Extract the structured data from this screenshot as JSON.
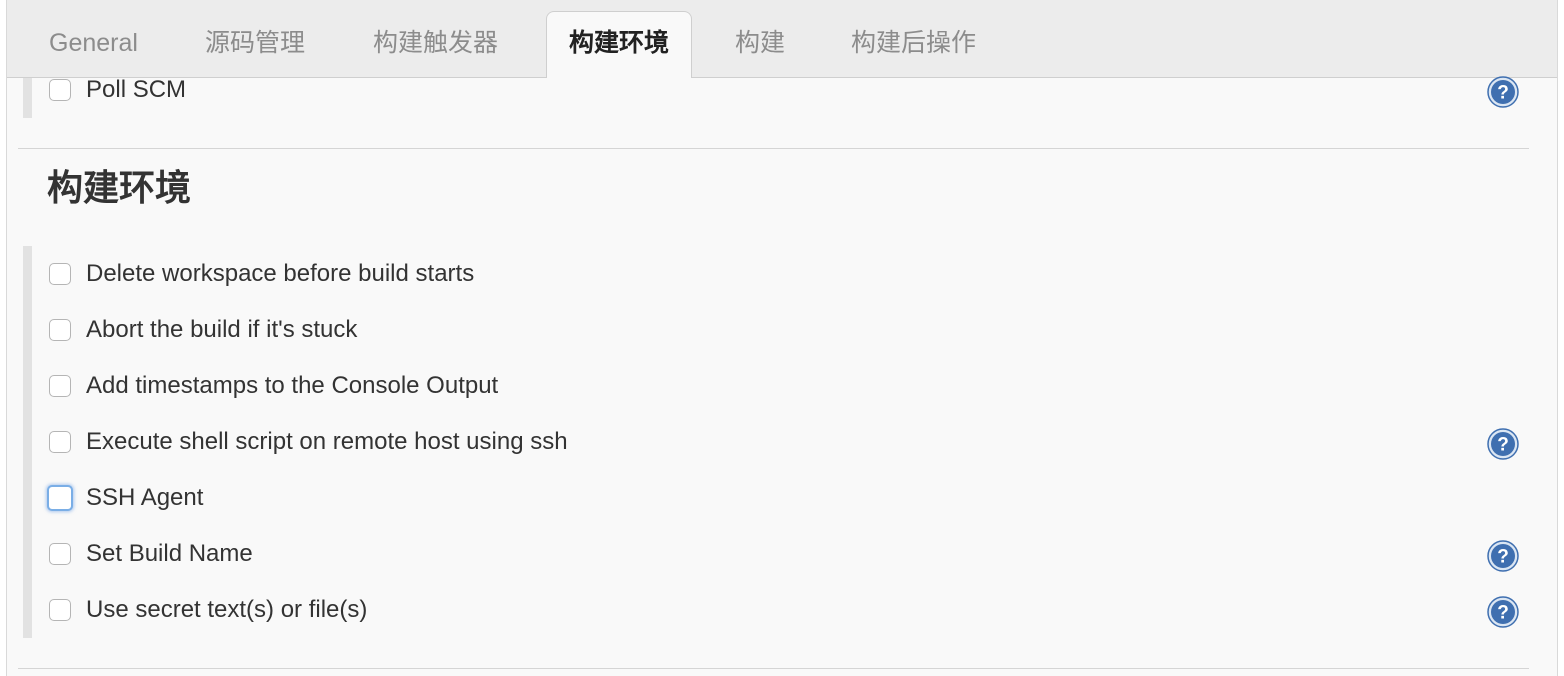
{
  "tabs": [
    {
      "label": "General"
    },
    {
      "label": "源码管理"
    },
    {
      "label": "构建触发器"
    },
    {
      "label": "构建环境",
      "active": true
    },
    {
      "label": "构建"
    },
    {
      "label": "构建后操作"
    }
  ],
  "triggers": {
    "poll_scm_label": "Poll SCM"
  },
  "build_environment": {
    "title": "构建环境",
    "options": [
      {
        "label": "Delete workspace before build starts",
        "checked": false
      },
      {
        "label": "Abort the build if it's stuck",
        "checked": false
      },
      {
        "label": "Add timestamps to the Console Output",
        "checked": false
      },
      {
        "label": "Execute shell script on remote host using ssh",
        "checked": false
      },
      {
        "label": "SSH Agent",
        "checked": false,
        "focused": true
      },
      {
        "label": "Set Build Name",
        "checked": false
      },
      {
        "label": "Use secret text(s) or file(s)",
        "checked": false
      }
    ]
  },
  "icons": {
    "help": "help-icon"
  },
  "colors": {
    "help_icon": "#3f6fb0",
    "focus_ring": "#7aaee6"
  }
}
